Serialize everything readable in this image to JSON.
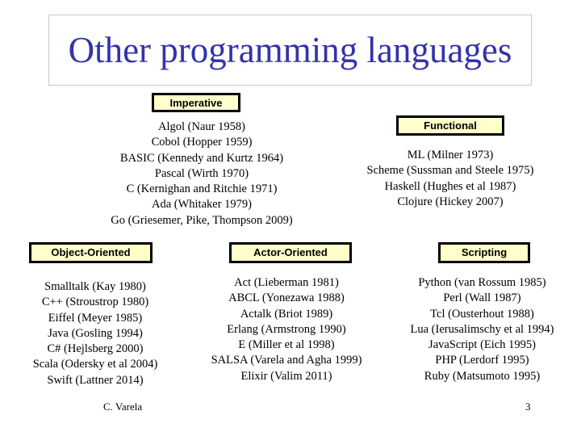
{
  "slide": {
    "title": "Other programming languages",
    "title_color": "#3333aa",
    "label_bg": "#ffffcc"
  },
  "categories": {
    "imperative": {
      "label": "Imperative",
      "items": [
        "Algol (Naur 1958)",
        "Cobol (Hopper 1959)",
        "BASIC (Kennedy and Kurtz 1964)",
        "Pascal (Wirth 1970)",
        "C (Kernighan and Ritchie 1971)",
        "Ada (Whitaker 1979)",
        "Go (Griesemer, Pike, Thompson 2009)"
      ]
    },
    "functional": {
      "label": "Functional",
      "items": [
        "ML (Milner 1973)",
        "Scheme (Sussman and Steele 1975)",
        "Haskell (Hughes et al 1987)",
        "Clojure (Hickey 2007)"
      ]
    },
    "object_oriented": {
      "label": "Object-Oriented",
      "items": [
        "Smalltalk (Kay 1980)",
        "C++ (Stroustrop 1980)",
        "Eiffel (Meyer 1985)",
        "Java (Gosling 1994)",
        "C# (Hejlsberg 2000)",
        "Scala (Odersky et al 2004)",
        "Swift (Lattner 2014)"
      ]
    },
    "actor_oriented": {
      "label": "Actor-Oriented",
      "items": [
        "Act (Lieberman 1981)",
        "ABCL (Yonezawa 1988)",
        "Actalk (Briot 1989)",
        "Erlang (Armstrong 1990)",
        "E (Miller et al 1998)",
        "SALSA (Varela and Agha 1999)",
        "Elixir (Valim 2011)"
      ]
    },
    "scripting": {
      "label": "Scripting",
      "items": [
        "Python (van Rossum 1985)",
        "Perl (Wall 1987)",
        "Tcl (Ousterhout 1988)",
        "Lua (Ierusalimschy et al 1994)",
        "JavaScript (Eich 1995)",
        "PHP (Lerdorf 1995)",
        "Ruby (Matsumoto 1995)"
      ]
    }
  },
  "footer": {
    "author": "C. Varela",
    "page_number": "3"
  }
}
